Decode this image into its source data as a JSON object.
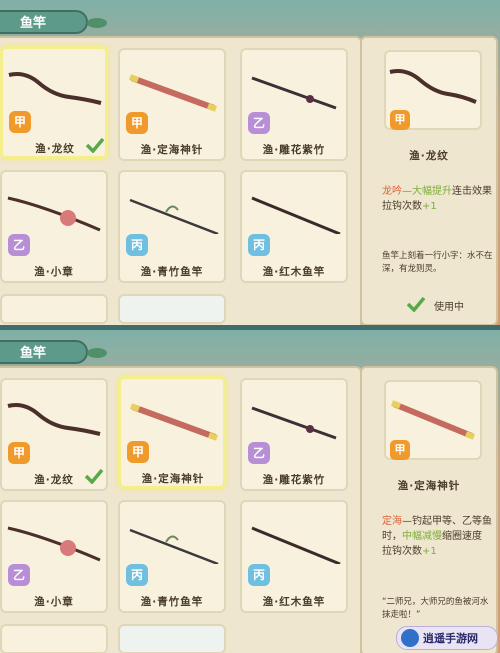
{
  "tab_title": "鱼竿",
  "top": {
    "cards": [
      {
        "name": "渔·龙纹",
        "grade": "甲",
        "grade_class": "jia",
        "selected": true,
        "equipped": true,
        "rod": "twisted-dark-rod"
      },
      {
        "name": "渔·定海神针",
        "grade": "甲",
        "grade_class": "jia",
        "selected": false,
        "equipped": false,
        "rod": "red-gold-staff"
      },
      {
        "name": "渔·雕花紫竹",
        "grade": "乙",
        "grade_class": "yi",
        "selected": false,
        "equipped": false,
        "rod": "purple-bamboo-rod"
      },
      {
        "name": "渔·小章",
        "grade": "乙",
        "grade_class": "yi",
        "selected": false,
        "equipped": false,
        "rod": "octopus-rod"
      },
      {
        "name": "渔·青竹鱼竿",
        "grade": "丙",
        "grade_class": "bing",
        "selected": false,
        "equipped": false,
        "rod": "green-bamboo-rod"
      },
      {
        "name": "渔·红木鱼竿",
        "grade": "丙",
        "grade_class": "bing",
        "selected": false,
        "equipped": false,
        "rod": "redwood-rod"
      }
    ],
    "detail": {
      "name": "渔·龙纹",
      "grade": "甲",
      "desc_prefix": "龙吟—",
      "desc_highlight": "大幅提升",
      "desc_rest": "连击效果",
      "desc_line2_label": "拉钩次数",
      "desc_line2_value": "+1",
      "quote": "鱼竿上刻着一行小字：水不在深，有龙则灵。",
      "status": "使用中"
    }
  },
  "bottom": {
    "cards": [
      {
        "name": "渔·龙纹",
        "grade": "甲",
        "grade_class": "jia",
        "selected": false,
        "equipped": true,
        "rod": "twisted-dark-rod"
      },
      {
        "name": "渔·定海神针",
        "grade": "甲",
        "grade_class": "jia",
        "selected": true,
        "equipped": false,
        "rod": "red-gold-staff"
      },
      {
        "name": "渔·雕花紫竹",
        "grade": "乙",
        "grade_class": "yi",
        "selected": false,
        "equipped": false,
        "rod": "purple-bamboo-rod"
      },
      {
        "name": "渔·小章",
        "grade": "乙",
        "grade_class": "yi",
        "selected": false,
        "equipped": false,
        "rod": "octopus-rod"
      },
      {
        "name": "渔·青竹鱼竿",
        "grade": "丙",
        "grade_class": "bing",
        "selected": false,
        "equipped": false,
        "rod": "green-bamboo-rod"
      },
      {
        "name": "渔·红木鱼竿",
        "grade": "丙",
        "grade_class": "bing",
        "selected": false,
        "equipped": false,
        "rod": "redwood-rod"
      }
    ],
    "detail": {
      "name": "渔·定海神针",
      "grade": "甲",
      "desc_prefix": "定海",
      "desc_mid": "—钓起甲等、乙等鱼时，",
      "desc_highlight": "中幅减慢",
      "desc_rest": "缩圈速度",
      "desc_line2_label": "拉钩次数",
      "desc_line2_value": "+1",
      "quote": "“二师兄，大师兄的鱼被河水抹走啦！”"
    }
  },
  "watermark": "逍遥手游网",
  "colors": {
    "grade_jia": "#f09a2b",
    "grade_yi": "#b88ed6",
    "grade_bing": "#6fbfe0",
    "highlight_red": "#d8643a",
    "highlight_green": "#7cae3a"
  }
}
